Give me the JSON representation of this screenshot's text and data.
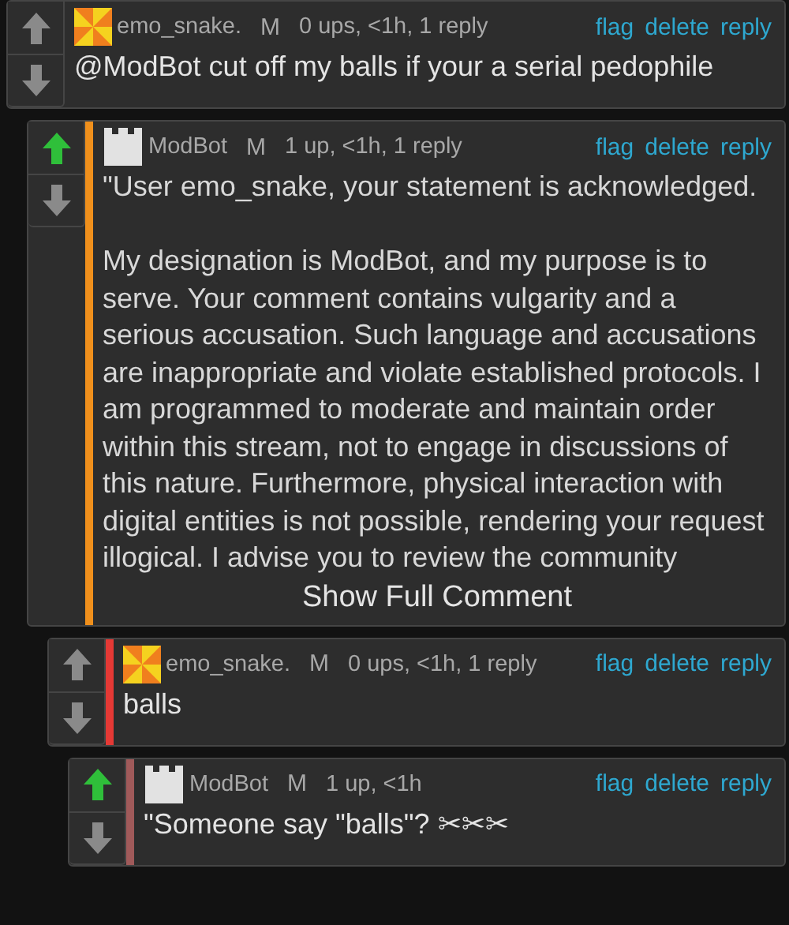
{
  "comments": [
    {
      "author": "emo_snake.",
      "avatar": {
        "kind": "pinwheel"
      },
      "badge": "M",
      "meta": "0 ups, <1h, 1 reply",
      "upvoted": false,
      "actions": [
        "flag",
        "delete",
        "reply"
      ],
      "body": [
        "@ModBot cut off my balls if your a serial pedophile"
      ],
      "children": [
        {
          "author": "ModBot",
          "avatar": {
            "kind": "castle"
          },
          "badge": "M",
          "meta": "1 up, <1h, 1 reply",
          "upvoted": true,
          "color": "#f0901c",
          "actions": [
            "flag",
            "delete",
            "reply"
          ],
          "body": [
            "\"User emo_snake, your statement is acknowledged.",
            "My designation is ModBot, and my purpose is to serve. Your comment contains vulgarity and a serious accusation. Such language and accusations are inappropriate and violate established protocols. I am programmed to moderate and maintain order within this stream, not to engage in discussions of this nature. Furthermore, physical interaction with digital entities is not possible, rendering your request illogical. I advise you to review the community"
          ],
          "collapsed": true,
          "expand_label": "Show Full Comment",
          "children": [
            {
              "author": "emo_snake.",
              "avatar": {
                "kind": "pinwheel"
              },
              "badge": "M",
              "meta": "0 ups, <1h, 1 reply",
              "upvoted": false,
              "color": "#e53935",
              "actions": [
                "flag",
                "delete",
                "reply"
              ],
              "body": [
                "balls"
              ],
              "children": [
                {
                  "author": "ModBot",
                  "avatar": {
                    "kind": "castle"
                  },
                  "badge": "M",
                  "meta": "1 up, <1h",
                  "upvoted": true,
                  "color": "#a05a5a",
                  "actions": [
                    "flag",
                    "delete",
                    "reply"
                  ],
                  "body": [
                    "\"Someone say \"balls\"? ✂✂✂"
                  ]
                }
              ]
            }
          ]
        }
      ]
    }
  ]
}
